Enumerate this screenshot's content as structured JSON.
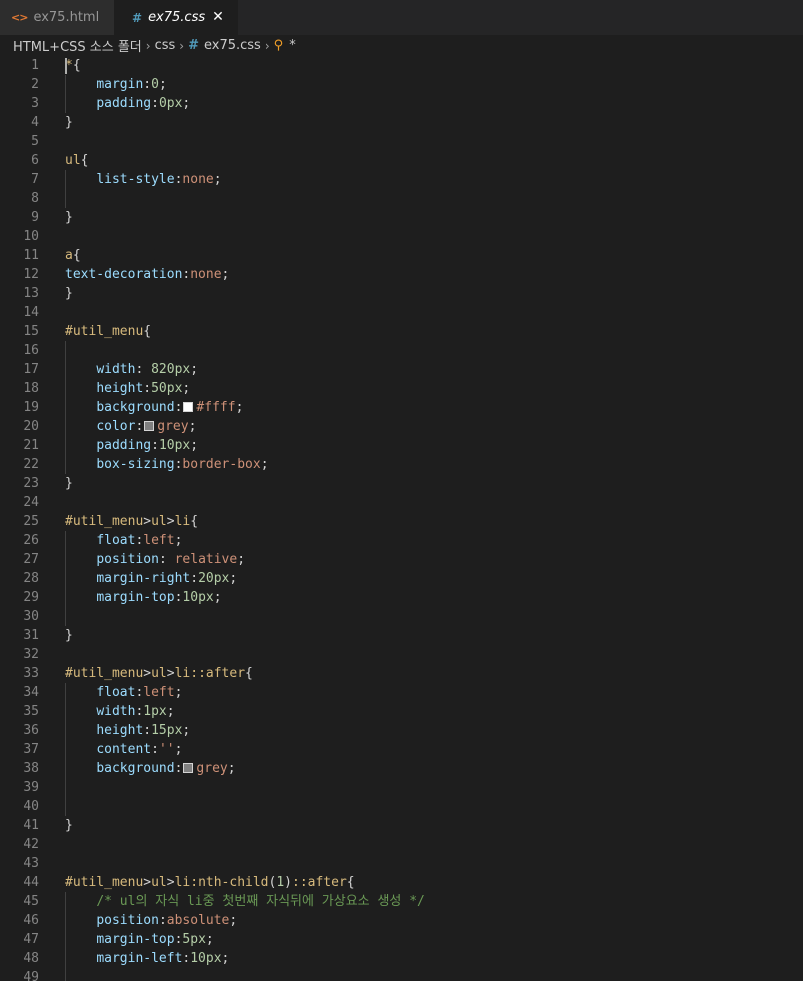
{
  "tabs": [
    {
      "label": "ex75.html",
      "icon": "html-code-icon",
      "active": false
    },
    {
      "label": "ex75.css",
      "icon": "css-hash-icon",
      "active": true
    }
  ],
  "breadcrumb": {
    "items": [
      "HTML+CSS 소스 폴더",
      "css",
      "ex75.css",
      "*"
    ],
    "icons": [
      "chevron-right-icon",
      "css-hash-icon",
      "structure-icon"
    ]
  },
  "colors": {
    "background": "#1e1e1e",
    "tabbar": "#252526",
    "swatch_white": "#ffffff",
    "swatch_grey": "#808080"
  },
  "editor": {
    "lines": [
      {
        "n": "1",
        "segs": [
          [
            "sel",
            "*"
          ],
          [
            "pun",
            "{"
          ]
        ],
        "cursor": true
      },
      {
        "n": "2",
        "segs": [
          [
            "pun",
            "    "
          ],
          [
            "prop",
            "margin"
          ],
          [
            "pun",
            ":"
          ],
          [
            "num",
            "0"
          ],
          [
            "pun",
            ";"
          ]
        ]
      },
      {
        "n": "3",
        "segs": [
          [
            "pun",
            "    "
          ],
          [
            "prop",
            "padding"
          ],
          [
            "pun",
            ":"
          ],
          [
            "num",
            "0px"
          ],
          [
            "pun",
            ";"
          ]
        ]
      },
      {
        "n": "4",
        "segs": [
          [
            "pun",
            "}"
          ]
        ]
      },
      {
        "n": "5",
        "segs": []
      },
      {
        "n": "6",
        "segs": [
          [
            "sel",
            "ul"
          ],
          [
            "pun",
            "{"
          ]
        ]
      },
      {
        "n": "7",
        "segs": [
          [
            "pun",
            "    "
          ],
          [
            "prop",
            "list-style"
          ],
          [
            "pun",
            ":"
          ],
          [
            "val",
            "none"
          ],
          [
            "pun",
            ";"
          ]
        ]
      },
      {
        "n": "8",
        "segs": []
      },
      {
        "n": "9",
        "segs": [
          [
            "pun",
            "}"
          ]
        ]
      },
      {
        "n": "10",
        "segs": []
      },
      {
        "n": "11",
        "segs": [
          [
            "sel",
            "a"
          ],
          [
            "pun",
            "{"
          ]
        ]
      },
      {
        "n": "12",
        "segs": [
          [
            "prop",
            "text-decoration"
          ],
          [
            "pun",
            ":"
          ],
          [
            "val",
            "none"
          ],
          [
            "pun",
            ";"
          ]
        ]
      },
      {
        "n": "13",
        "segs": [
          [
            "pun",
            "}"
          ]
        ]
      },
      {
        "n": "14",
        "segs": []
      },
      {
        "n": "15",
        "segs": [
          [
            "sel",
            "#util_menu"
          ],
          [
            "pun",
            "{"
          ]
        ]
      },
      {
        "n": "16",
        "segs": []
      },
      {
        "n": "17",
        "segs": [
          [
            "pun",
            "    "
          ],
          [
            "prop",
            "width"
          ],
          [
            "pun",
            ": "
          ],
          [
            "num",
            "820px"
          ],
          [
            "pun",
            ";"
          ]
        ]
      },
      {
        "n": "18",
        "segs": [
          [
            "pun",
            "    "
          ],
          [
            "prop",
            "height"
          ],
          [
            "pun",
            ":"
          ],
          [
            "num",
            "50px"
          ],
          [
            "pun",
            ";"
          ]
        ]
      },
      {
        "n": "19",
        "segs": [
          [
            "pun",
            "    "
          ],
          [
            "prop",
            "background"
          ],
          [
            "pun",
            ":"
          ],
          [
            "swatch",
            "#ffffff"
          ],
          [
            "val",
            "#ffff"
          ],
          [
            "pun",
            ";"
          ]
        ]
      },
      {
        "n": "20",
        "segs": [
          [
            "pun",
            "    "
          ],
          [
            "prop",
            "color"
          ],
          [
            "pun",
            ":"
          ],
          [
            "swatch",
            "#808080"
          ],
          [
            "val",
            "grey"
          ],
          [
            "pun",
            ";"
          ]
        ]
      },
      {
        "n": "21",
        "segs": [
          [
            "pun",
            "    "
          ],
          [
            "prop",
            "padding"
          ],
          [
            "pun",
            ":"
          ],
          [
            "num",
            "10px"
          ],
          [
            "pun",
            ";"
          ]
        ]
      },
      {
        "n": "22",
        "segs": [
          [
            "pun",
            "    "
          ],
          [
            "prop",
            "box-sizing"
          ],
          [
            "pun",
            ":"
          ],
          [
            "val",
            "border-box"
          ],
          [
            "pun",
            ";"
          ]
        ]
      },
      {
        "n": "23",
        "segs": [
          [
            "pun",
            "}"
          ]
        ]
      },
      {
        "n": "24",
        "segs": []
      },
      {
        "n": "25",
        "segs": [
          [
            "sel",
            "#util_menu"
          ],
          [
            "pun",
            ">"
          ],
          [
            "sel",
            "ul"
          ],
          [
            "pun",
            ">"
          ],
          [
            "sel",
            "li"
          ],
          [
            "pun",
            "{"
          ]
        ]
      },
      {
        "n": "26",
        "segs": [
          [
            "pun",
            "    "
          ],
          [
            "prop",
            "float"
          ],
          [
            "pun",
            ":"
          ],
          [
            "val",
            "left"
          ],
          [
            "pun",
            ";"
          ]
        ]
      },
      {
        "n": "27",
        "segs": [
          [
            "pun",
            "    "
          ],
          [
            "prop",
            "position"
          ],
          [
            "pun",
            ": "
          ],
          [
            "val",
            "relative"
          ],
          [
            "pun",
            ";"
          ]
        ]
      },
      {
        "n": "28",
        "segs": [
          [
            "pun",
            "    "
          ],
          [
            "prop",
            "margin-right"
          ],
          [
            "pun",
            ":"
          ],
          [
            "num",
            "20px"
          ],
          [
            "pun",
            ";"
          ]
        ]
      },
      {
        "n": "29",
        "segs": [
          [
            "pun",
            "    "
          ],
          [
            "prop",
            "margin-top"
          ],
          [
            "pun",
            ":"
          ],
          [
            "num",
            "10px"
          ],
          [
            "pun",
            ";"
          ]
        ]
      },
      {
        "n": "30",
        "segs": []
      },
      {
        "n": "31",
        "segs": [
          [
            "pun",
            "}"
          ]
        ]
      },
      {
        "n": "32",
        "segs": []
      },
      {
        "n": "33",
        "segs": [
          [
            "sel",
            "#util_menu"
          ],
          [
            "pun",
            ">"
          ],
          [
            "sel",
            "ul"
          ],
          [
            "pun",
            ">"
          ],
          [
            "sel",
            "li::after"
          ],
          [
            "pun",
            "{"
          ]
        ]
      },
      {
        "n": "34",
        "segs": [
          [
            "pun",
            "    "
          ],
          [
            "prop",
            "float"
          ],
          [
            "pun",
            ":"
          ],
          [
            "val",
            "left"
          ],
          [
            "pun",
            ";"
          ]
        ]
      },
      {
        "n": "35",
        "segs": [
          [
            "pun",
            "    "
          ],
          [
            "prop",
            "width"
          ],
          [
            "pun",
            ":"
          ],
          [
            "num",
            "1px"
          ],
          [
            "pun",
            ";"
          ]
        ]
      },
      {
        "n": "36",
        "segs": [
          [
            "pun",
            "    "
          ],
          [
            "prop",
            "height"
          ],
          [
            "pun",
            ":"
          ],
          [
            "num",
            "15px"
          ],
          [
            "pun",
            ";"
          ]
        ]
      },
      {
        "n": "37",
        "segs": [
          [
            "pun",
            "    "
          ],
          [
            "prop",
            "content"
          ],
          [
            "pun",
            ":"
          ],
          [
            "str",
            "''"
          ],
          [
            "pun",
            ";"
          ]
        ]
      },
      {
        "n": "38",
        "segs": [
          [
            "pun",
            "    "
          ],
          [
            "prop",
            "background"
          ],
          [
            "pun",
            ":"
          ],
          [
            "swatch",
            "#808080"
          ],
          [
            "val",
            "grey"
          ],
          [
            "pun",
            ";"
          ]
        ]
      },
      {
        "n": "39",
        "segs": []
      },
      {
        "n": "40",
        "segs": []
      },
      {
        "n": "41",
        "segs": [
          [
            "pun",
            "}"
          ]
        ]
      },
      {
        "n": "42",
        "segs": []
      },
      {
        "n": "43",
        "segs": []
      },
      {
        "n": "44",
        "segs": [
          [
            "sel",
            "#util_menu"
          ],
          [
            "pun",
            ">"
          ],
          [
            "sel",
            "ul"
          ],
          [
            "pun",
            ">"
          ],
          [
            "sel",
            "li:nth-child"
          ],
          [
            "pun",
            "("
          ],
          [
            "num",
            "1"
          ],
          [
            "pun",
            ")"
          ],
          [
            "sel",
            "::after"
          ],
          [
            "pun",
            "{"
          ]
        ]
      },
      {
        "n": "45",
        "segs": [
          [
            "pun",
            "    "
          ],
          [
            "cmt",
            "/* ul의 자식 li중 첫번째 자식뒤에 가상요소 생성 */"
          ]
        ]
      },
      {
        "n": "46",
        "segs": [
          [
            "pun",
            "    "
          ],
          [
            "prop",
            "position"
          ],
          [
            "pun",
            ":"
          ],
          [
            "val",
            "absolute"
          ],
          [
            "pun",
            ";"
          ]
        ]
      },
      {
        "n": "47",
        "segs": [
          [
            "pun",
            "    "
          ],
          [
            "prop",
            "margin-top"
          ],
          [
            "pun",
            ":"
          ],
          [
            "num",
            "5px"
          ],
          [
            "pun",
            ";"
          ]
        ]
      },
      {
        "n": "48",
        "segs": [
          [
            "pun",
            "    "
          ],
          [
            "prop",
            "margin-left"
          ],
          [
            "pun",
            ":"
          ],
          [
            "num",
            "10px"
          ],
          [
            "pun",
            ";"
          ]
        ]
      },
      {
        "n": "49",
        "segs": []
      }
    ]
  }
}
